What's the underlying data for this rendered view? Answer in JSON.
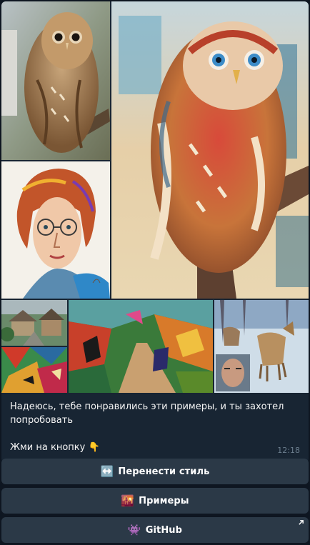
{
  "message": {
    "caption_line1": "Надеюсь, тебе понравились эти примеры, и ты захотел попробовать",
    "caption_line2": "Жми на кнопку",
    "caption_emoji": "👇",
    "time": "12:18"
  },
  "keyboard": {
    "transfer": {
      "emoji": "↔️",
      "label": "Перенести стиль"
    },
    "examples": {
      "emoji": "🌇",
      "label": "Примеры"
    },
    "github": {
      "emoji": "👾",
      "label": "GitHub"
    }
  },
  "colors": {
    "background": "#0e1621",
    "bubble": "#182533",
    "button": "#2b3947",
    "time_text": "#6d7f8f"
  },
  "icons": {
    "external_link": "arrow-up-right-icon"
  }
}
